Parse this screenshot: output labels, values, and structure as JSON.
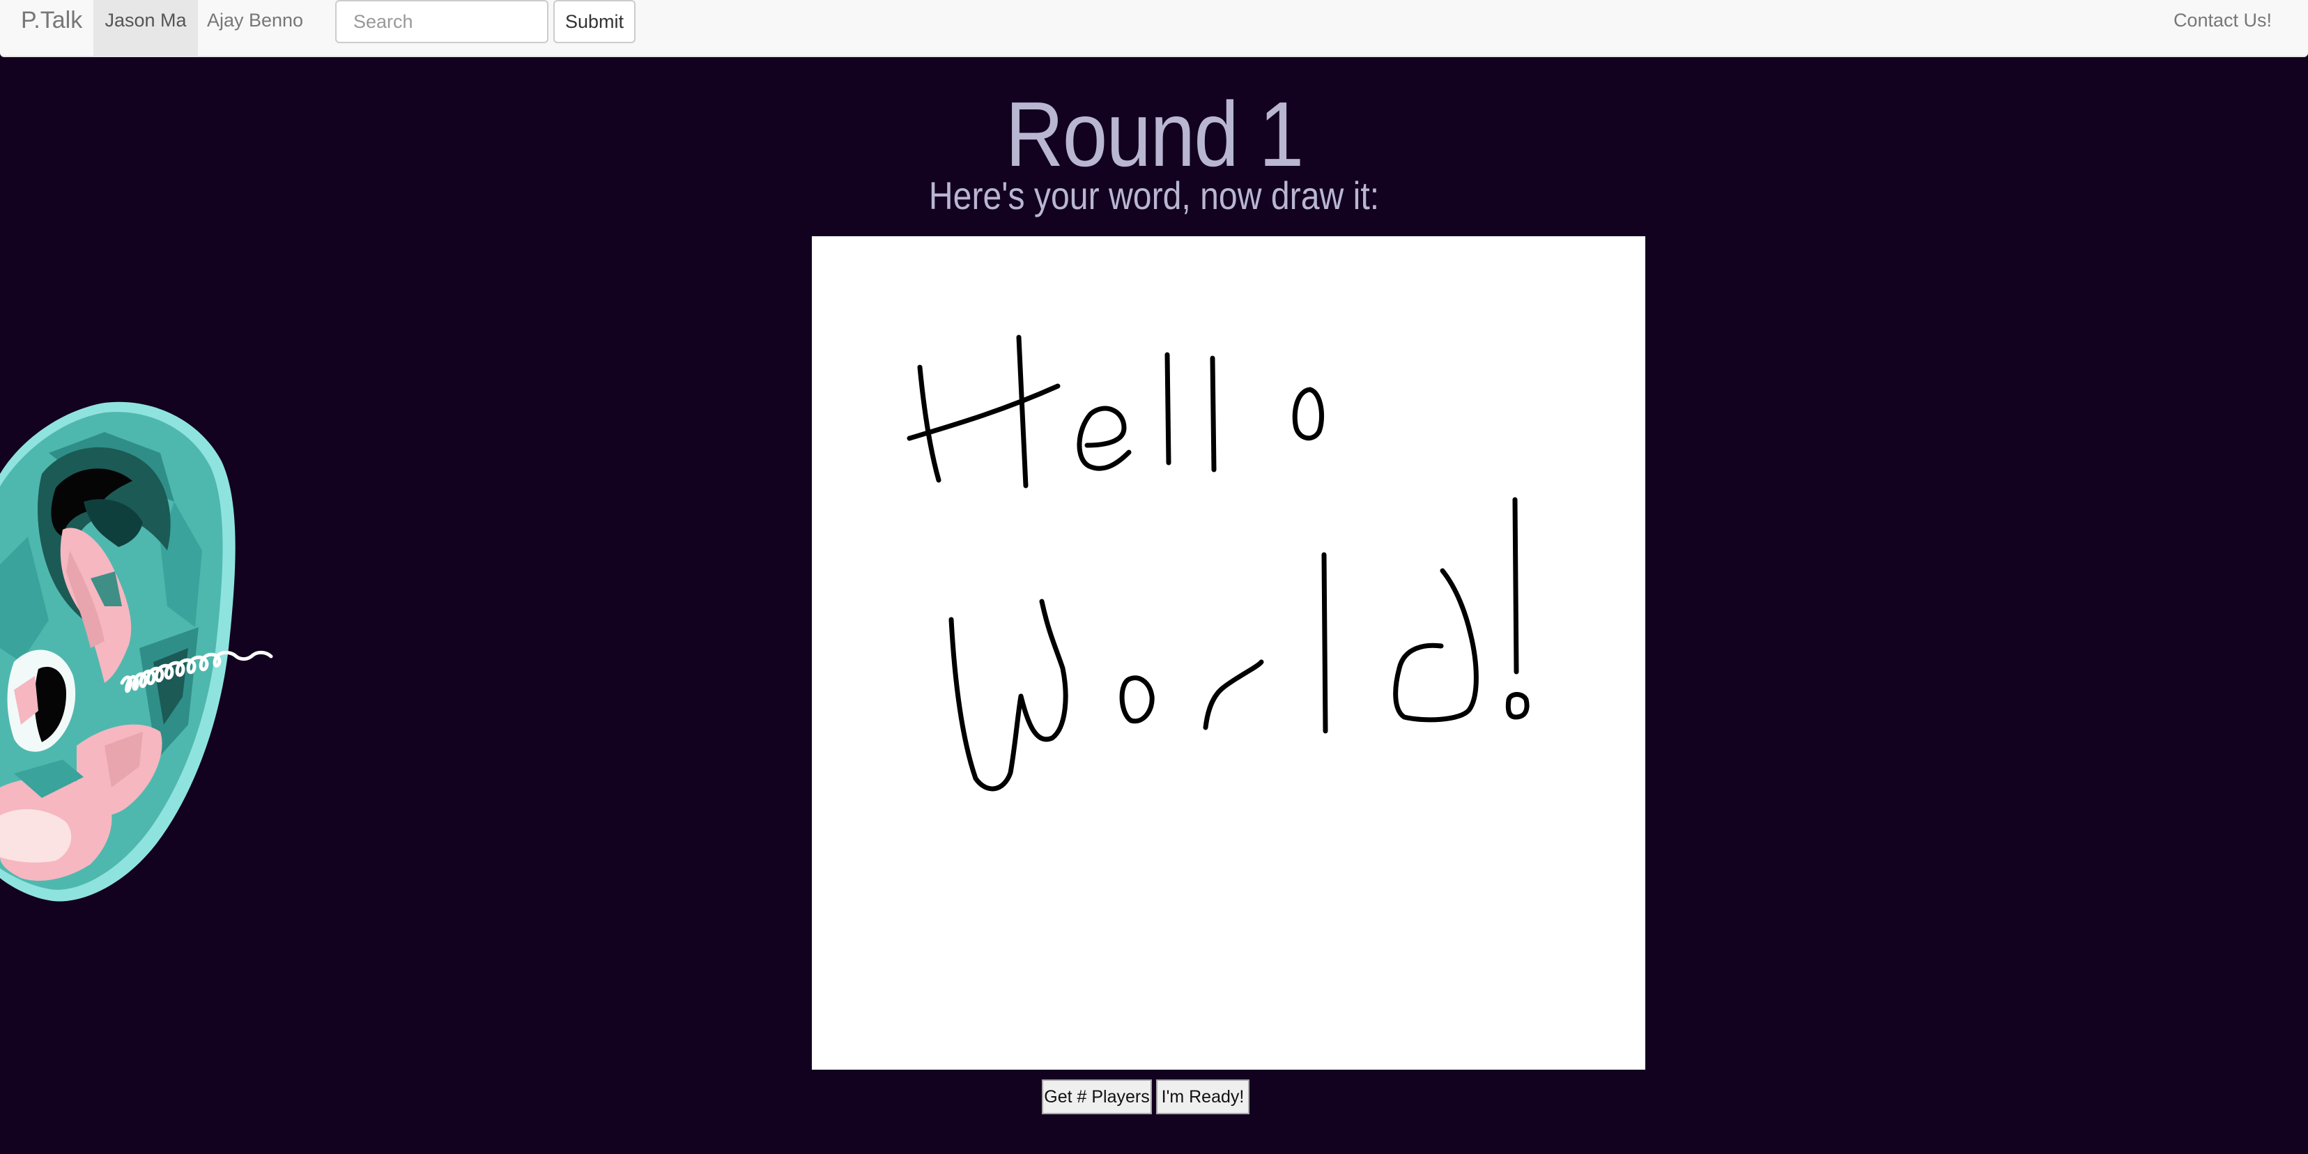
{
  "navbar": {
    "brand": "P.Talk",
    "items": [
      {
        "label": "Jason Ma",
        "active": true
      },
      {
        "label": "Ajay Benno",
        "active": false
      }
    ],
    "search": {
      "placeholder": "Search",
      "value": ""
    },
    "submit_label": "Submit",
    "contact_label": "Contact Us!"
  },
  "game": {
    "title": "Round 1",
    "prompt": "Here's your word, now draw it:",
    "buttons": {
      "players_label": "Get # Players",
      "ready_label": "I'm Ready!"
    }
  },
  "colors": {
    "background": "#12021f",
    "heading": "#b9b6d2",
    "ear_teal": "#4fb8ae",
    "ear_pink": "#f6b7c0"
  },
  "icons": {
    "ear": "ear-illustration",
    "drawing": "hand-drawn-hello-world"
  }
}
